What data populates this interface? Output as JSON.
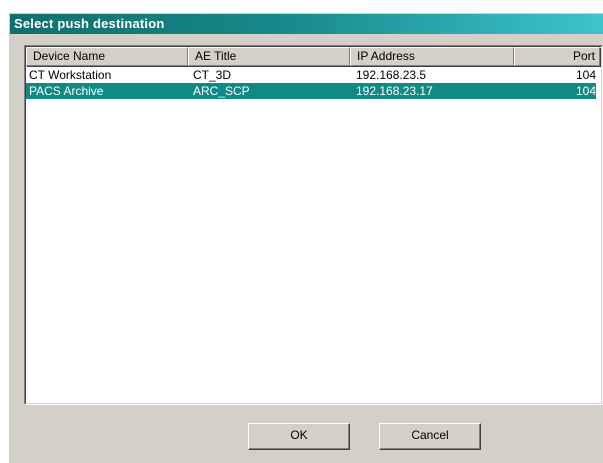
{
  "dialog": {
    "title": "Select push destination"
  },
  "list": {
    "columns": [
      "Device Name",
      "AE Title",
      "IP Address",
      "Port"
    ],
    "rows": [
      {
        "device_name": "CT Workstation",
        "ae_title": "CT_3D",
        "ip_address": "192.168.23.5",
        "port": "104",
        "selected": false
      },
      {
        "device_name": "PACS Archive",
        "ae_title": "ARC_SCP",
        "ip_address": "192.168.23.17",
        "port": "104",
        "selected": true
      }
    ]
  },
  "buttons": {
    "ok_label": "OK",
    "cancel_label": "Cancel"
  },
  "colors": {
    "selection": "#0f8a87",
    "titlebar_start": "#0f6f6e",
    "titlebar_end": "#3ec6cf"
  }
}
